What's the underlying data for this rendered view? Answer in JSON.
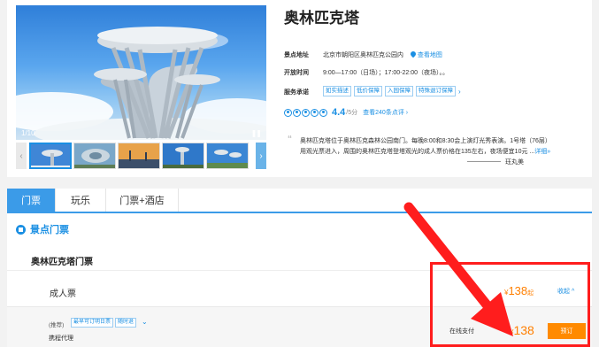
{
  "attraction": {
    "title": "奥林匹克塔",
    "image_counter": "1/10",
    "pause_glyph": "❚❚",
    "thumb_left_glyph": "‹",
    "thumb_right_glyph": "›",
    "address_label": "景点地址",
    "address": "北京市朝阳区奥林匹克公园内",
    "map_link": "查看地图",
    "hours_label": "开放时间",
    "hours": "9:00—17:00（日场）；17:00-22:00（夜场）。。",
    "service_label": "服务承诺",
    "service_tags": [
      "如实描述",
      "低价保障",
      "入园保障",
      "特殊退订保障"
    ],
    "service_more": "›",
    "rating": "4.4",
    "rating_max": "/5分",
    "reviews_link": "查看240条点评 ›",
    "description_line1": "奥林匹克塔位于奥林匹克森林公园南门。每晚8:00和8:30会上演灯光秀表演。1号塔（76层）",
    "description_line2": "用观光票进入，周围的奥林匹克塔登塔观光的成人票价格在135左右，夜场便宜10元 ...",
    "description_more": "详细»",
    "quote_mark": "“",
    "author": "珏丸美"
  },
  "tabs": [
    "门票",
    "玩乐",
    "门票+酒店"
  ],
  "tickets": {
    "section_title": "景点门票",
    "group_title": "奥林匹克塔门票",
    "adult_label": "成人票",
    "currency": "¥",
    "price_from": "138",
    "price_from_suffix": "起",
    "collapse_link": "收起 ^",
    "recommend_label": "(推荐)",
    "recommend_tags": [
      "最早可订明日票",
      "随时退"
    ],
    "expand_glyph": "⌄",
    "agent": "携程代理",
    "pay_label": "在线支付",
    "price": "138",
    "book_button": "预订"
  },
  "colors": {
    "accent_blue": "#1a8fe3",
    "tab_blue": "#3b9be8",
    "price_orange": "#ff7f00",
    "book_orange": "#ff8a00",
    "annotation_red": "#ff1d1d"
  }
}
